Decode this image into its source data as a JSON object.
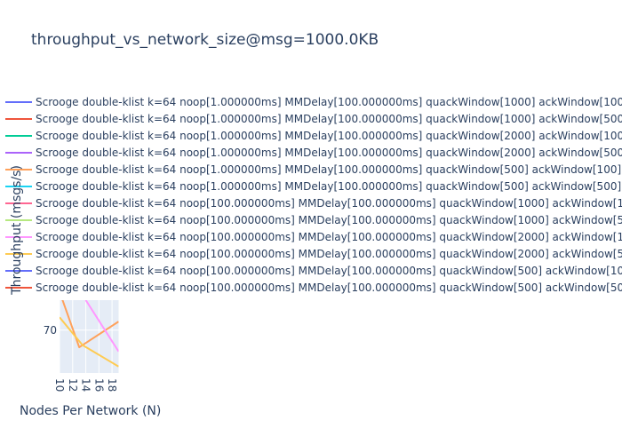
{
  "chart_data": {
    "type": "line",
    "title": "throughput_vs_network_size@msg=1000.0KB",
    "xlabel": "Nodes Per Network (N)",
    "ylabel": "Throughput (msgs/s)",
    "x_ticks": [
      10,
      12,
      14,
      16,
      18
    ],
    "y_ticks": [
      70
    ],
    "xlim": [
      10,
      19
    ],
    "ylim": [
      60,
      77
    ],
    "grid": true,
    "legend_position": "top",
    "series": [
      {
        "name": "Scrooge double-klist k=64 noop[1.000000ms] MMDelay[100.000000ms] quackWindow[1000] ackWindow[100",
        "color": "#636efa",
        "x": [],
        "y": []
      },
      {
        "name": "Scrooge double-klist k=64 noop[1.000000ms] MMDelay[100.000000ms] quackWindow[1000] ackWindow[500",
        "color": "#EF553B",
        "x": [],
        "y": []
      },
      {
        "name": "Scrooge double-klist k=64 noop[1.000000ms] MMDelay[100.000000ms] quackWindow[2000] ackWindow[100",
        "color": "#00cc96",
        "x": [],
        "y": []
      },
      {
        "name": "Scrooge double-klist k=64 noop[1.000000ms] MMDelay[100.000000ms] quackWindow[2000] ackWindow[500",
        "color": "#ab63fa",
        "x": [],
        "y": []
      },
      {
        "name": "Scrooge double-klist k=64 noop[1.000000ms] MMDelay[100.000000ms] quackWindow[500] ackWindow[100]",
        "color": "#FFA15A",
        "x": [
          10,
          13,
          19
        ],
        "y": [
          79,
          66,
          72
        ]
      },
      {
        "name": "Scrooge double-klist k=64 noop[1.000000ms] MMDelay[100.000000ms] quackWindow[500] ackWindow[500]",
        "color": "#19d3f3",
        "x": [],
        "y": []
      },
      {
        "name": "Scrooge double-klist k=64 noop[100.000000ms] MMDelay[100.000000ms] quackWindow[1000] ackWindow[1",
        "color": "#FF6692",
        "x": [],
        "y": []
      },
      {
        "name": "Scrooge double-klist k=64 noop[100.000000ms] MMDelay[100.000000ms] quackWindow[1000] ackWindow[5",
        "color": "#B6E880",
        "x": [],
        "y": []
      },
      {
        "name": "Scrooge double-klist k=64 noop[100.000000ms] MMDelay[100.000000ms] quackWindow[2000] ackWindow[1",
        "color": "#FF97FF",
        "x": [
          14,
          19
        ],
        "y": [
          77,
          65
        ]
      },
      {
        "name": "Scrooge double-klist k=64 noop[100.000000ms] MMDelay[100.000000ms] quackWindow[2000] ackWindow[5",
        "color": "#FECB52",
        "x": [
          10,
          13.5,
          19
        ],
        "y": [
          73,
          66.5,
          61.5
        ]
      },
      {
        "name": "Scrooge double-klist k=64 noop[100.000000ms] MMDelay[100.000000ms] quackWindow[500] ackWindow[10",
        "color": "#636efa",
        "x": [],
        "y": []
      },
      {
        "name": "Scrooge double-klist k=64 noop[100.000000ms] MMDelay[100.000000ms] quackWindow[500] ackWindow[50",
        "color": "#EF553B",
        "x": [],
        "y": []
      }
    ]
  }
}
